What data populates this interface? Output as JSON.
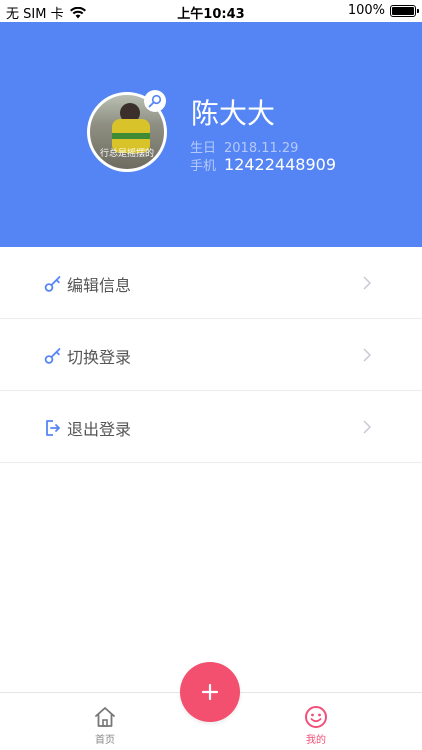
{
  "status_bar": {
    "carrier": "无 SIM 卡",
    "time": "上午10:43",
    "battery": "100%",
    "battery_level": 1.0
  },
  "profile": {
    "name": "陈大大",
    "avatar_caption": "行总是摇摆的",
    "birthday_label": "生日",
    "birthday": "2018.11.29",
    "phone_label": "手机",
    "phone": "12422448909"
  },
  "menu": {
    "items": [
      {
        "label": "编辑信息",
        "icon": "key-icon"
      },
      {
        "label": "切换登录",
        "icon": "key-icon"
      },
      {
        "label": "退出登录",
        "icon": "logout-icon"
      }
    ]
  },
  "tab_bar": {
    "home_label": "首页",
    "mine_label": "我的",
    "add_icon": "plus-icon"
  },
  "colors": {
    "header_bg": "#5585f4",
    "accent_pink": "#f2506e",
    "icon_blue": "#5585f4"
  }
}
